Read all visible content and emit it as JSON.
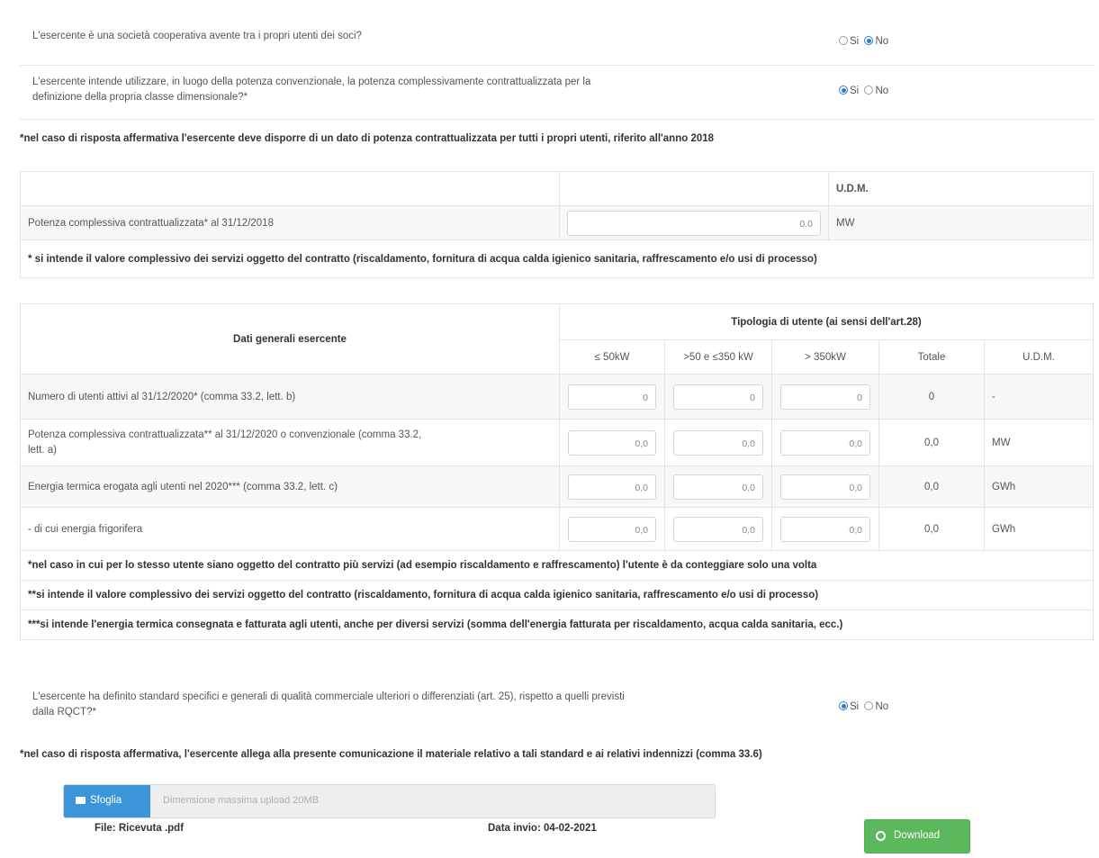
{
  "radio_labels": {
    "yes": "Si",
    "no": "No"
  },
  "q1": {
    "text": "L'esercente è una società cooperativa avente tra i propri utenti dei soci?",
    "selected": "no"
  },
  "q2": {
    "text_line1": "L'esercente intende utilizzare, in luogo della potenza convenzionale, la potenza complessivamente contrattualizzata per la",
    "text_line2": "definizione della propria classe dimensionale?*",
    "selected": "yes"
  },
  "note1": "*nel caso di risposta affermativa l'esercente deve disporre di un dato di potenza contrattualizzata per tutti i propri utenti, riferito all'anno 2018",
  "table1": {
    "udm_header": "U.D.M.",
    "row_label": "Potenza complessiva contrattualizzata* al 31/12/2018",
    "row_value": "0.0",
    "row_udm": "MW",
    "footnote": "* si intende il valore complessivo dei servizi oggetto del contratto (riscaldamento, fornitura di acqua calda igienico sanitaria, raffrescamento e/o usi di processo)"
  },
  "table2": {
    "left_header": "Dati generali esercente",
    "group_header": "Tipologia di utente (ai sensi dell'art.28)",
    "columns": [
      "≤ 50kW",
      ">50 e ≤350 kW",
      "> 350kW",
      "Totale",
      "U.D.M."
    ],
    "rows": [
      {
        "label": "Numero di utenti attivi al 31/12/2020* (comma 33.2, lett. b)",
        "values": [
          "0",
          "0",
          "0"
        ],
        "total": "0",
        "udm": "-"
      },
      {
        "label_line1": "Potenza complessiva contrattualizzata** al 31/12/2020 o convenzionale (comma 33.2,",
        "label_line2": "lett. a)",
        "values": [
          "0,0",
          "0,0",
          "0,0"
        ],
        "total": "0,0",
        "udm": "MW"
      },
      {
        "label": "Energia termica erogata agli utenti nel 2020*** (comma 33.2, lett. c)",
        "values": [
          "0,0",
          "0,0",
          "0,0"
        ],
        "total": "0,0",
        "udm": "GWh"
      },
      {
        "label": " - di cui energia frigorifera",
        "values": [
          "0,0",
          "0,0",
          "0,0"
        ],
        "total": "0,0",
        "udm": "GWh"
      }
    ],
    "notes": [
      "*nel caso in cui per lo stesso utente siano oggetto del contratto più servizi (ad esempio riscaldamento e raffrescamento) l'utente è da conteggiare solo una volta",
      "**si intende il valore complessivo dei servizi oggetto del contratto (riscaldamento, fornitura di acqua calda igienico sanitaria, raffrescamento e/o usi di processo)",
      "***si intende l'energia termica consegnata e fatturata agli utenti, anche per diversi servizi (somma dell'energia fatturata per riscaldamento, acqua calda sanitaria, ecc.)"
    ]
  },
  "q3": {
    "text_line1": "L'esercente ha definito standard specifici e generali di qualità commerciale ulteriori o differenziati (art. 25), rispetto a quelli previsti",
    "text_line2": "dalla RQCT?*",
    "selected": "yes"
  },
  "note3": "*nel caso di risposta affermativa, l'esercente allega alla presente comunicazione il materiale relativo a tali standard e ai relativi indennizzi (comma 33.6)",
  "upload": {
    "button_label": "Sfoglia",
    "placeholder": "Dimensione massima upload 20MB",
    "file_text": "File: Ricevuta .pdf",
    "date_text": "Data invio: 04-02-2021",
    "download_label": "Download"
  },
  "colors": {
    "primary": "#2b7bd1",
    "browse": "#3b95d8",
    "download": "#5cb85c"
  }
}
